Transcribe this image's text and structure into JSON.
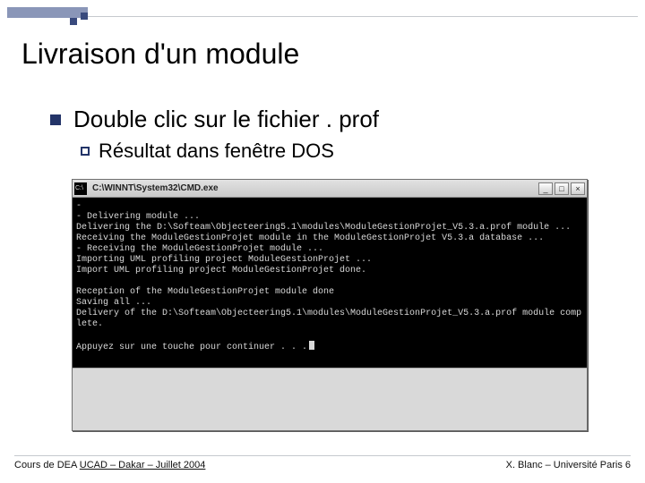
{
  "slide": {
    "title": "Livraison d'un module",
    "bullet1": "Double clic sur le fichier . prof",
    "bullet2": "Résultat dans fenêtre DOS"
  },
  "dos": {
    "titlebar": "C:\\WINNT\\System32\\CMD.exe",
    "buttons": {
      "min": "_",
      "max": "□",
      "close": "×"
    },
    "lines": [
      "-",
      "- Delivering module ...",
      "Delivering the D:\\Softeam\\Objecteering5.1\\modules\\ModuleGestionProjet_V5.3.a.prof module ...",
      "Receiving the ModuleGestionProjet module in the ModuleGestionProjet V5.3.a database ...",
      "- Receiving the ModuleGestionProjet module ...",
      "Importing UML profiling project ModuleGestionProjet ...",
      "Import UML profiling project ModuleGestionProjet done.",
      "",
      "Reception of the ModuleGestionProjet module done",
      "Saving all ...",
      "Delivery of the D:\\Softeam\\Objecteering5.1\\modules\\ModuleGestionProjet_V5.3.a.prof module complete.",
      "",
      "Appuyez sur une touche pour continuer . . ."
    ]
  },
  "footer": {
    "left_prefix": "Cours de DEA ",
    "left_underlined": "UCAD – Dakar – Juillet 2004",
    "right": "X. Blanc – Université Paris 6"
  }
}
